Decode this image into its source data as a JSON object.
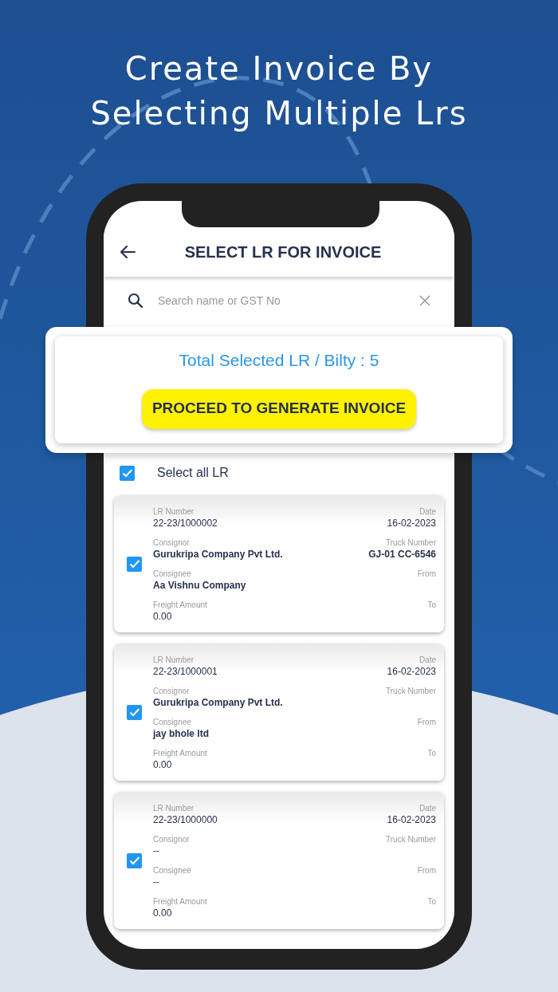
{
  "headline": [
    "Create Invoice By",
    "Selecting Multiple Lrs"
  ],
  "app_bar": {
    "title": "SELECT LR FOR INVOICE"
  },
  "search": {
    "placeholder": "Search name or GST No"
  },
  "summary": {
    "text": "Total Selected LR / Bilty : 5",
    "button": "PROCEED TO GENERATE INVOICE"
  },
  "select_all": {
    "label": "Select all LR",
    "checked": true
  },
  "cards": [
    {
      "checked": true,
      "rows": [
        {
          "left": {
            "label": "LR Number",
            "value": "22-23/1000002"
          },
          "right": {
            "label": "Date",
            "value": "16-02-2023"
          }
        },
        {
          "left": {
            "label": "Consignor",
            "value": "Gurukripa Company Pvt Ltd."
          },
          "right": {
            "label": "Truck Number",
            "value": "GJ-01 CC-6546"
          }
        },
        {
          "left": {
            "label": "Consignee",
            "value": "Aa Vishnu Company"
          },
          "right": {
            "label": "From"
          }
        },
        {
          "left": {
            "label": "Freight Amount",
            "value": "0.00"
          },
          "right": {
            "label": "To"
          }
        }
      ]
    },
    {
      "checked": true,
      "rows": [
        {
          "left": {
            "label": "LR Number",
            "value": "22-23/1000001"
          },
          "right": {
            "label": "Date",
            "value": "16-02-2023"
          }
        },
        {
          "left": {
            "label": "Consignor",
            "value": "Gurukripa Company Pvt Ltd."
          },
          "right": {
            "label": "Truck Number"
          }
        },
        {
          "left": {
            "label": "Consignee",
            "value": "jay bhole ltd"
          },
          "right": {
            "label": "From"
          }
        },
        {
          "left": {
            "label": "Freight Amount",
            "value": "0.00"
          },
          "right": {
            "label": "To"
          }
        }
      ]
    },
    {
      "checked": true,
      "rows": [
        {
          "left": {
            "label": "LR Number",
            "value": "22-23/1000000"
          },
          "right": {
            "label": "Date",
            "value": "16-02-2023"
          }
        },
        {
          "left": {
            "label": "Consignor",
            "value": "--"
          },
          "right": {
            "label": "Truck Number"
          }
        },
        {
          "left": {
            "label": "Consignee",
            "value": "--"
          },
          "right": {
            "label": "From"
          }
        },
        {
          "left": {
            "label": "Freight Amount",
            "value": "0.00"
          },
          "right": {
            "label": "To"
          }
        }
      ]
    }
  ]
}
